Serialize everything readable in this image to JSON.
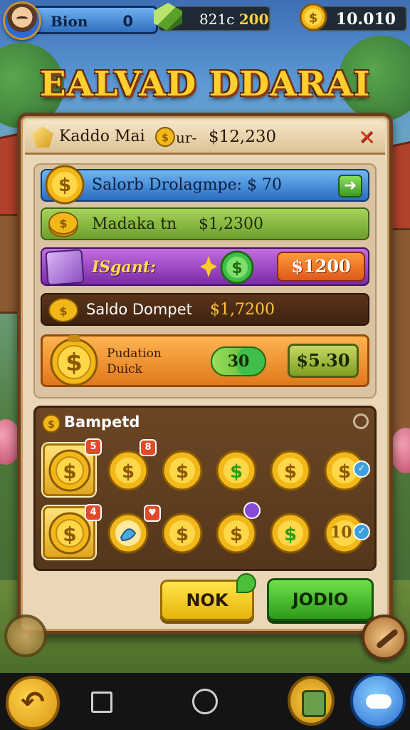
{
  "hud": {
    "player_name": "Bion",
    "player_level": "0",
    "gems_prefix": "821c",
    "gems_value": "200",
    "gold_value": "10.010"
  },
  "title": "EALVAD DDARAI",
  "panel": {
    "header": {
      "name": "Kaddo Mai",
      "label": "ur-",
      "amount": "$12,230",
      "close_symbol": "✕"
    },
    "rows": {
      "saldo_label": "Salorb Drolagmpe: $ 70",
      "go_symbol": "➜",
      "madaka_label": "Madaka  tn",
      "madaka_amount": "$1,2300",
      "special_label": "ISgant:",
      "special_price": "$1200",
      "dompet_label": "Saldo Dompet",
      "dompet_amount": "$1,7200",
      "pudation_line1": "Pudation",
      "pudation_line2": "Duick",
      "bonus_value": "30",
      "buy_price": "$5.30"
    },
    "grid": {
      "title": "Bampetd",
      "badges": [
        "5",
        "8",
        "4",
        "♥",
        "✓",
        "✓"
      ],
      "tile_text_10": "10"
    },
    "buttons": {
      "ok_label": "NOK",
      "join_label": "JODIO"
    }
  },
  "nav": {
    "back_symbol": "↶"
  },
  "colors": {
    "panel_bg": "#e9d7b8",
    "panel_border": "#6a3d1e",
    "gold": "#ffcf2e",
    "blue_row": "#2b6cc0",
    "green_row": "#6e9e2c",
    "purple_row": "#7a2aa6",
    "orange_row": "#e0781c"
  }
}
